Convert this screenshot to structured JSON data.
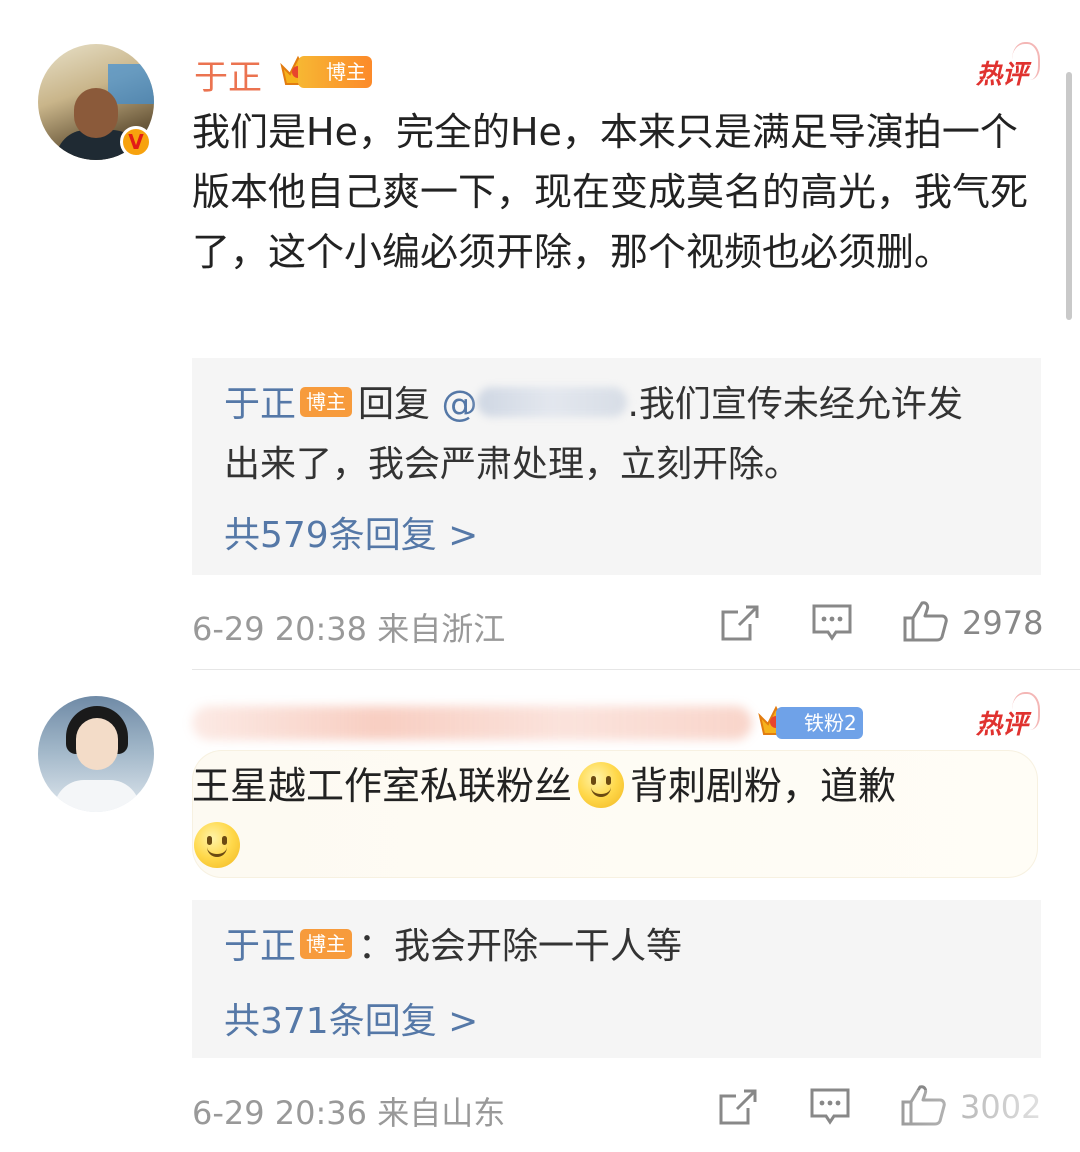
{
  "comments": [
    {
      "author": "于正",
      "author_badge": "博主",
      "hot_label": "热评",
      "text": "我们是He，完全的He，本来只是满足导演拍一个版本他自己爽一下，现在变成莫名的高光，我气死了，这个小编必须开除，那个视频也必须删。",
      "reply": {
        "name": "于正",
        "badge": "博主",
        "verb": "回复",
        "mention_prefix": "@",
        "text": ".我们宣传未经允许发",
        "text_line2": "出来了，我会严肃处理，立刻开除。",
        "count_label": "共579条回复 >"
      },
      "date": "6-29 20:38",
      "location": "来自浙江",
      "likes": "2978"
    },
    {
      "author_badge": "铁粉2",
      "hot_label": "热评",
      "text_part1": "王星越工作室私联粉丝",
      "text_part2": "背刺剧粉，道歉",
      "reply": {
        "name": "于正",
        "badge": "博主",
        "text": "：我会开除一干人等",
        "count_label": "共371条回复 >"
      },
      "date": "6-29 20:36",
      "location": "来自山东",
      "likes": "3002"
    }
  ],
  "icons": {
    "share": "share-icon",
    "comment": "comment-icon",
    "like": "thumbs-up-icon",
    "verified": "verified-v-badge",
    "crown": "crown-icon",
    "smiley": "smiley-emoji"
  },
  "colors": {
    "author_name": "#eb7350",
    "reply_link": "#5578a7",
    "hot": "#e0322f",
    "badge_orange": "#f79b3c",
    "fan_badge": "#6fa2e8"
  },
  "verified_mark": "V"
}
